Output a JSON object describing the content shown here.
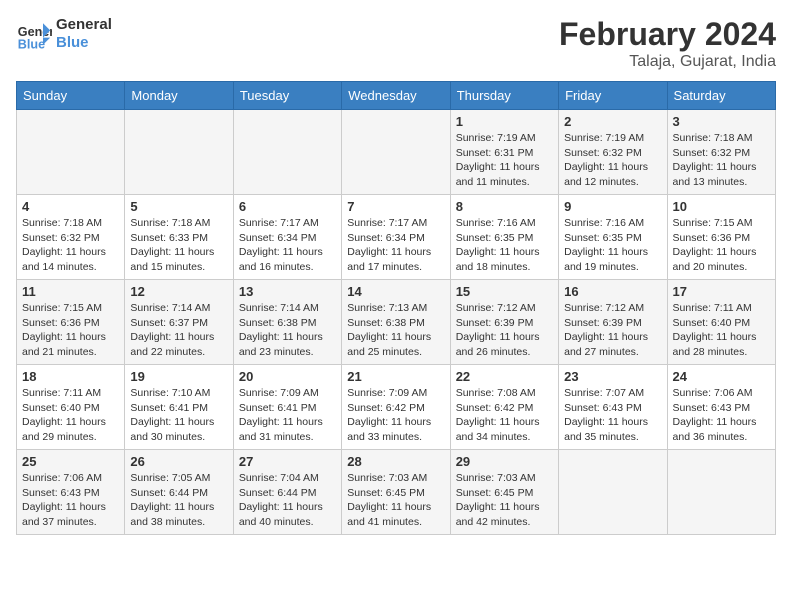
{
  "header": {
    "logo_line1": "General",
    "logo_line2": "Blue",
    "month_year": "February 2024",
    "location": "Talaja, Gujarat, India"
  },
  "days_of_week": [
    "Sunday",
    "Monday",
    "Tuesday",
    "Wednesday",
    "Thursday",
    "Friday",
    "Saturday"
  ],
  "weeks": [
    [
      {
        "day": "",
        "info": ""
      },
      {
        "day": "",
        "info": ""
      },
      {
        "day": "",
        "info": ""
      },
      {
        "day": "",
        "info": ""
      },
      {
        "day": "1",
        "info": "Sunrise: 7:19 AM\nSunset: 6:31 PM\nDaylight: 11 hours\nand 11 minutes."
      },
      {
        "day": "2",
        "info": "Sunrise: 7:19 AM\nSunset: 6:32 PM\nDaylight: 11 hours\nand 12 minutes."
      },
      {
        "day": "3",
        "info": "Sunrise: 7:18 AM\nSunset: 6:32 PM\nDaylight: 11 hours\nand 13 minutes."
      }
    ],
    [
      {
        "day": "4",
        "info": "Sunrise: 7:18 AM\nSunset: 6:32 PM\nDaylight: 11 hours\nand 14 minutes."
      },
      {
        "day": "5",
        "info": "Sunrise: 7:18 AM\nSunset: 6:33 PM\nDaylight: 11 hours\nand 15 minutes."
      },
      {
        "day": "6",
        "info": "Sunrise: 7:17 AM\nSunset: 6:34 PM\nDaylight: 11 hours\nand 16 minutes."
      },
      {
        "day": "7",
        "info": "Sunrise: 7:17 AM\nSunset: 6:34 PM\nDaylight: 11 hours\nand 17 minutes."
      },
      {
        "day": "8",
        "info": "Sunrise: 7:16 AM\nSunset: 6:35 PM\nDaylight: 11 hours\nand 18 minutes."
      },
      {
        "day": "9",
        "info": "Sunrise: 7:16 AM\nSunset: 6:35 PM\nDaylight: 11 hours\nand 19 minutes."
      },
      {
        "day": "10",
        "info": "Sunrise: 7:15 AM\nSunset: 6:36 PM\nDaylight: 11 hours\nand 20 minutes."
      }
    ],
    [
      {
        "day": "11",
        "info": "Sunrise: 7:15 AM\nSunset: 6:36 PM\nDaylight: 11 hours\nand 21 minutes."
      },
      {
        "day": "12",
        "info": "Sunrise: 7:14 AM\nSunset: 6:37 PM\nDaylight: 11 hours\nand 22 minutes."
      },
      {
        "day": "13",
        "info": "Sunrise: 7:14 AM\nSunset: 6:38 PM\nDaylight: 11 hours\nand 23 minutes."
      },
      {
        "day": "14",
        "info": "Sunrise: 7:13 AM\nSunset: 6:38 PM\nDaylight: 11 hours\nand 25 minutes."
      },
      {
        "day": "15",
        "info": "Sunrise: 7:12 AM\nSunset: 6:39 PM\nDaylight: 11 hours\nand 26 minutes."
      },
      {
        "day": "16",
        "info": "Sunrise: 7:12 AM\nSunset: 6:39 PM\nDaylight: 11 hours\nand 27 minutes."
      },
      {
        "day": "17",
        "info": "Sunrise: 7:11 AM\nSunset: 6:40 PM\nDaylight: 11 hours\nand 28 minutes."
      }
    ],
    [
      {
        "day": "18",
        "info": "Sunrise: 7:11 AM\nSunset: 6:40 PM\nDaylight: 11 hours\nand 29 minutes."
      },
      {
        "day": "19",
        "info": "Sunrise: 7:10 AM\nSunset: 6:41 PM\nDaylight: 11 hours\nand 30 minutes."
      },
      {
        "day": "20",
        "info": "Sunrise: 7:09 AM\nSunset: 6:41 PM\nDaylight: 11 hours\nand 31 minutes."
      },
      {
        "day": "21",
        "info": "Sunrise: 7:09 AM\nSunset: 6:42 PM\nDaylight: 11 hours\nand 33 minutes."
      },
      {
        "day": "22",
        "info": "Sunrise: 7:08 AM\nSunset: 6:42 PM\nDaylight: 11 hours\nand 34 minutes."
      },
      {
        "day": "23",
        "info": "Sunrise: 7:07 AM\nSunset: 6:43 PM\nDaylight: 11 hours\nand 35 minutes."
      },
      {
        "day": "24",
        "info": "Sunrise: 7:06 AM\nSunset: 6:43 PM\nDaylight: 11 hours\nand 36 minutes."
      }
    ],
    [
      {
        "day": "25",
        "info": "Sunrise: 7:06 AM\nSunset: 6:43 PM\nDaylight: 11 hours\nand 37 minutes."
      },
      {
        "day": "26",
        "info": "Sunrise: 7:05 AM\nSunset: 6:44 PM\nDaylight: 11 hours\nand 38 minutes."
      },
      {
        "day": "27",
        "info": "Sunrise: 7:04 AM\nSunset: 6:44 PM\nDaylight: 11 hours\nand 40 minutes."
      },
      {
        "day": "28",
        "info": "Sunrise: 7:03 AM\nSunset: 6:45 PM\nDaylight: 11 hours\nand 41 minutes."
      },
      {
        "day": "29",
        "info": "Sunrise: 7:03 AM\nSunset: 6:45 PM\nDaylight: 11 hours\nand 42 minutes."
      },
      {
        "day": "",
        "info": ""
      },
      {
        "day": "",
        "info": ""
      }
    ]
  ]
}
